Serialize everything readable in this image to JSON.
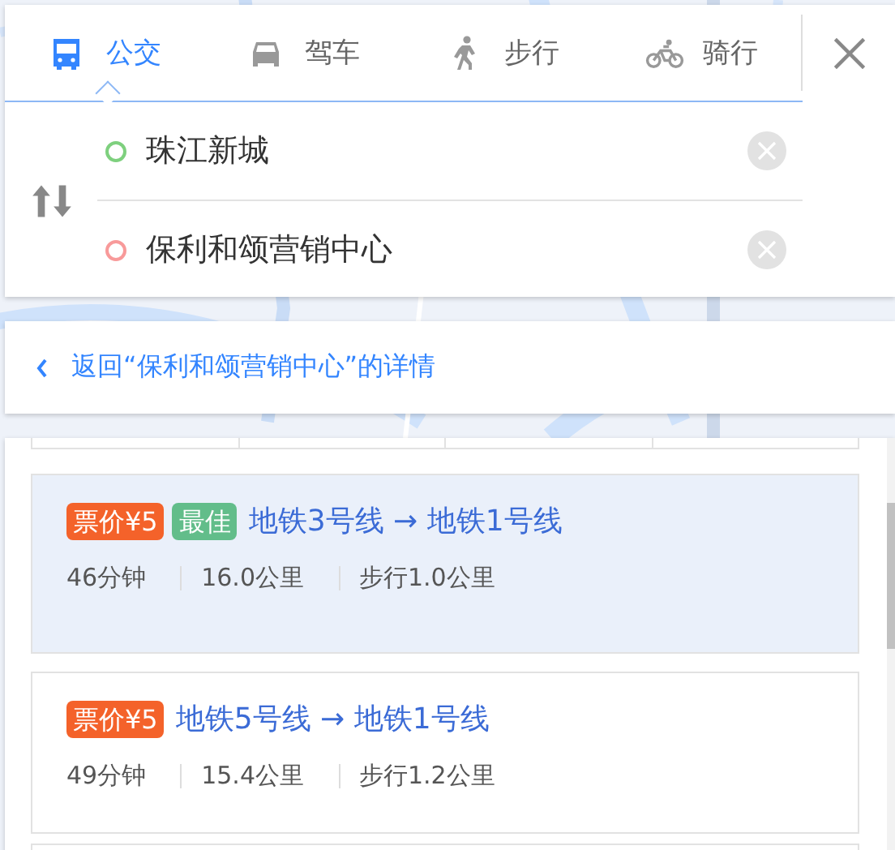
{
  "tabs": [
    {
      "label": "公交",
      "kind": "bus",
      "selected": true
    },
    {
      "label": "驾车",
      "kind": "car",
      "selected": false
    },
    {
      "label": "步行",
      "kind": "walk",
      "selected": false
    },
    {
      "label": "骑行",
      "kind": "bike",
      "selected": false
    }
  ],
  "inputs": [
    {
      "kind": "start",
      "value": "珠江新城"
    },
    {
      "kind": "end",
      "value": "保利和颂营销中心"
    }
  ],
  "back_link": {
    "text": "返回“保利和颂营销中心”的详情"
  },
  "routes": [
    {
      "fare": "票价¥5",
      "best": "最佳",
      "title": "地铁3号线 → 地铁1号线",
      "duration": "46分钟",
      "distance": "16.0公里",
      "walk": "步行1.0公里",
      "selected": true
    },
    {
      "fare": "票价¥5",
      "title": "地铁5号线 → 地铁1号线",
      "duration": "49分钟",
      "distance": "15.4公里",
      "walk": "步行1.2公里",
      "selected": false
    }
  ]
}
